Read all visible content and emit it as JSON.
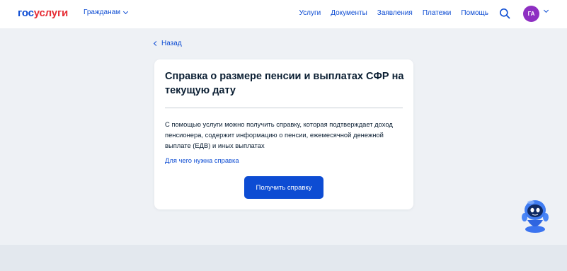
{
  "header": {
    "logo_part1": "гос",
    "logo_part2": "услуги",
    "audience_label": "Гражданам",
    "nav": [
      "Услуги",
      "Документы",
      "Заявления",
      "Платежи",
      "Помощь"
    ],
    "avatar_initials": "ГА"
  },
  "back_label": "Назад",
  "card": {
    "title": "Справка о размере пенсии и выплатах СФР на текущую дату",
    "description": "С помощью услуги можно получить справку, которая подтверждает доход пенсионера, содержит информацию о пенсии, ежемесячной денежной выплате (ЕДВ) и иных выплатах",
    "link_label": "Для чего нужна справка",
    "button_label": "Получить справку"
  },
  "colors": {
    "brand_blue": "#0d4cd3",
    "brand_red": "#e62d35",
    "avatar": "#8e2fc2",
    "page_bg": "#eef1f5"
  },
  "icons": [
    "chevron-down-icon",
    "search-icon",
    "chevron-left-icon",
    "robot-assistant-icon"
  ]
}
